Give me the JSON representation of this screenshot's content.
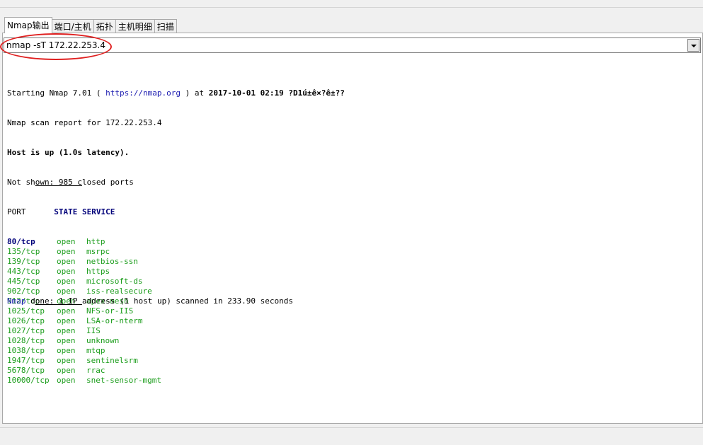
{
  "tabs": [
    {
      "label": "Nmap输出",
      "active": true
    },
    {
      "label": "端口/主机",
      "active": false
    },
    {
      "label": "拓扑",
      "active": false
    },
    {
      "label": "主机明细",
      "active": false
    },
    {
      "label": "扫描",
      "active": false
    }
  ],
  "command": {
    "value": "nmap -sT 172.22.253.4"
  },
  "output": {
    "start_prefix": "Starting Nmap 7.01 ( ",
    "start_url": "https://nmap.org",
    "start_mid": " ) at ",
    "start_time": "2017-10-01 02:19",
    "start_tz": " ?D1ú±ê×?ê±??",
    "report": "Nmap scan report for 172.22.253.4",
    "host_up": "Host is up (1.0s latency).",
    "not_shown_a": "Not sh",
    "not_shown_b": "own: 985 c",
    "not_shown_c": "losed ports",
    "header_port": "PORT      ",
    "header_rest": "STATE SERVICE",
    "ports": [
      {
        "port": "80/tcp",
        "state": "open",
        "service": "http"
      },
      {
        "port": "135/tcp",
        "state": "open",
        "service": "msrpc"
      },
      {
        "port": "139/tcp",
        "state": "open",
        "service": "netbios-ssn"
      },
      {
        "port": "443/tcp",
        "state": "open",
        "service": "https"
      },
      {
        "port": "445/tcp",
        "state": "open",
        "service": "microsoft-ds"
      },
      {
        "port": "902/tcp",
        "state": "open",
        "service": "iss-realsecure"
      },
      {
        "port": "912/tcp",
        "state": "open",
        "service": "apex-mesh"
      },
      {
        "port": "1025/tcp",
        "state": "open",
        "service": "NFS-or-IIS"
      },
      {
        "port": "1026/tcp",
        "state": "open",
        "service": "LSA-or-nterm"
      },
      {
        "port": "1027/tcp",
        "state": "open",
        "service": "IIS"
      },
      {
        "port": "1028/tcp",
        "state": "open",
        "service": "unknown"
      },
      {
        "port": "1038/tcp",
        "state": "open",
        "service": "mtqp"
      },
      {
        "port": "1947/tcp",
        "state": "open",
        "service": "sentinelsrm"
      },
      {
        "port": "5678/tcp",
        "state": "open",
        "service": "rrac"
      },
      {
        "port": "10000/tcp",
        "state": "open",
        "service": "snet-sensor-mgmt"
      }
    ],
    "done_a": "Nmap",
    "done_b": " d",
    "done_c": "one: 1 IP ",
    "done_d": "address (1 host up) scanned in 233.90 seconds"
  }
}
